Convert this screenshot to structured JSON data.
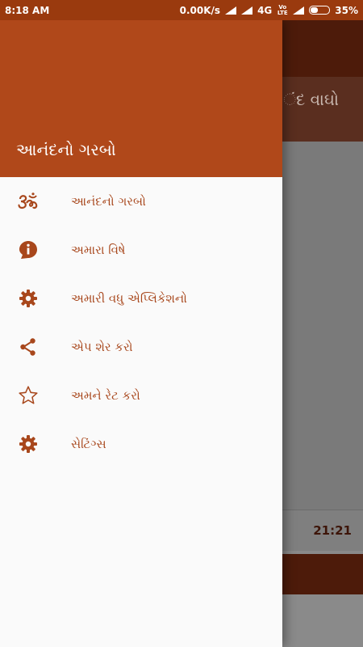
{
  "status_bar": {
    "time": "8:18 AM",
    "speed": "0.00K/s",
    "network": "4G",
    "volte": "Vo LTE",
    "battery": "35%",
    "battery_level": 0.35
  },
  "background": {
    "header_text": "ંદ વાઘો",
    "duration": "21:21"
  },
  "drawer": {
    "title": "આનંદનો ગરબો",
    "items": [
      {
        "label": "આનંદનો ગરબો",
        "icon": "om-icon"
      },
      {
        "label": "અમારા વિષે",
        "icon": "info-icon"
      },
      {
        "label": "અમારી વધુ એપ્લિકેશનો",
        "icon": "gear-icon"
      },
      {
        "label": "એપ શેર કરો",
        "icon": "share-icon"
      },
      {
        "label": "અમને રેટ કરો",
        "icon": "star-icon"
      },
      {
        "label": "સેટિંગ્સ",
        "icon": "gear-icon"
      }
    ]
  },
  "colors": {
    "accent": "#b0481a",
    "accent_dark": "#9a3a0e",
    "text_accent": "#a8471c"
  }
}
